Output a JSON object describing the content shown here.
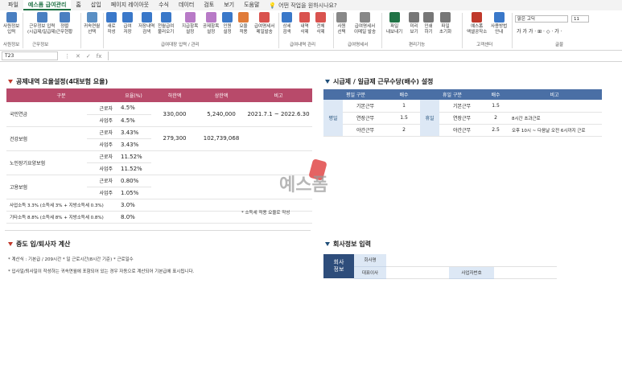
{
  "tabs": [
    "파일",
    "예스폼 급여관리",
    "홈",
    "삽입",
    "페이지 레이아웃",
    "수식",
    "데이터",
    "검토",
    "보기",
    "도움말"
  ],
  "tell_me": "어떤 작업을 원하시나요?",
  "ribbon": {
    "buttons": [
      {
        "label": "사원정보\n입력",
        "color": "#4a7fc1"
      },
      {
        "label": "근무정보 입력\n(시급제/일급제)",
        "color": "#4a7fc1"
      },
      {
        "label": "정렬\n근무현황",
        "color": "#4a7fc1"
      },
      {
        "label": "귀속연월\n선택",
        "color": "#5a8fc4"
      },
      {
        "label": "새로\n작성",
        "color": "#3a78c9"
      },
      {
        "label": "급여\n저장",
        "color": "#3a78c9"
      },
      {
        "label": "저장내역\n검색",
        "color": "#3a78c9"
      },
      {
        "label": "전월급여\n불러오기",
        "color": "#3a78c9"
      },
      {
        "label": "지급항목\n설정",
        "color": "#b87ac7"
      },
      {
        "label": "공제항목\n설정",
        "color": "#b87ac7"
      },
      {
        "label": "인원\n설정",
        "color": "#3a78c9"
      },
      {
        "label": "요율\n적용",
        "color": "#e07b39"
      },
      {
        "label": "급여명세서\n메일발송",
        "color": "#d9534f"
      },
      {
        "label": "상세\n검색",
        "color": "#3a78c9"
      },
      {
        "label": "내역\n삭제",
        "color": "#d9534f"
      },
      {
        "label": "전체\n삭제",
        "color": "#d9534f"
      },
      {
        "label": "사원\n선택",
        "color": "#888"
      },
      {
        "label": "급여명세서\n이메일 발송",
        "color": "#888"
      },
      {
        "label": "파일\n내보내기",
        "color": "#217346"
      },
      {
        "label": "미리\n보기",
        "color": "#777"
      },
      {
        "label": "인쇄\n하기",
        "color": "#777"
      },
      {
        "label": "파일\n초기화",
        "color": "#777"
      },
      {
        "label": "예스폼\n액셀공작소",
        "color": "#c0392b"
      },
      {
        "label": "사용방법\n안내",
        "color": "#3a78c9"
      }
    ],
    "groups": [
      "사원정보",
      "근무정보",
      "급여대장 입력 / 관리",
      "급여내역 관리",
      "급여명세서",
      "편리기능",
      "고객센터",
      "글꼴"
    ],
    "font_name": "맑은 고딕",
    "font_size": "11",
    "font_buttons": "가  가  가  ·  ⊞  ·  ◇  ·  가  ·"
  },
  "formula_bar": {
    "name_box": "T23",
    "icons": [
      "⋮",
      "✕",
      "✓",
      "fx"
    ]
  },
  "section1": {
    "title": "공제내역 요율설정(4대보험 요율)",
    "headers": [
      "구분",
      "요율(%)",
      "하한액",
      "상한액",
      "비고"
    ],
    "rows": [
      {
        "name": "국민연금",
        "sub": [
          [
            "근로자",
            "4.5%"
          ],
          [
            "사업주",
            "4.5%"
          ]
        ],
        "min": "330,000",
        "max": "5,240,000",
        "note": "2021.7.1 ~ 2022.6.30"
      },
      {
        "name": "건강보험",
        "sub": [
          [
            "근로자",
            "3.43%"
          ],
          [
            "사업주",
            "3.43%"
          ]
        ],
        "min": "279,300",
        "max": "102,739,068",
        "note": ""
      },
      {
        "name": "노인장기요양보험",
        "sub": [
          [
            "근로자",
            "11.52%"
          ],
          [
            "사업주",
            "11.52%"
          ]
        ],
        "min": "",
        "max": "",
        "note": ""
      },
      {
        "name": "고용보험",
        "sub": [
          [
            "근로자",
            "0.80%"
          ],
          [
            "사업주",
            "1.05%"
          ]
        ],
        "min": "",
        "max": "",
        "note": ""
      }
    ],
    "tax_rows": [
      {
        "name": "사업소득 3.3% (소득세 3% + 지방소득세 0.3%)",
        "rate": "3.0%"
      },
      {
        "name": "기타소득 8.8% (소득세 8% + 지방소득세 0.8%)",
        "rate": "8.0%"
      }
    ],
    "tax_note": "* 소득세 적용 요율로 작성"
  },
  "section2": {
    "title": "시급제 / 일급제 근무수당(배수) 설정",
    "headers": [
      "평일 구분",
      "배수",
      "휴일 구분",
      "배수",
      "비고"
    ],
    "weekday_label": "평일",
    "holiday_label": "휴일",
    "rows": [
      {
        "wd": "기본근무",
        "wdm": "1",
        "hd": "기본근무",
        "hdm": "1.5",
        "note": ""
      },
      {
        "wd": "연장근무",
        "wdm": "1.5",
        "hd": "연장근무",
        "hdm": "2",
        "note": "8시간 초과근로"
      },
      {
        "wd": "야간근무",
        "wdm": "2",
        "hd": "야간근무",
        "hdm": "2.5",
        "note": "오후 10시 ~ 다음날 오전 6시까지 근로"
      }
    ]
  },
  "section3": {
    "title": "중도 입/퇴사자 계산",
    "notes": [
      "* 계산식 : 기본급 / 209시간 * 일 근로시간(8시간 기준) * 근로일수",
      "* 입사일/퇴사일이 작성하는 귀속연월에 포함되어 있는 경우 자동으로 계산되어 기본급에 표시됩니다."
    ]
  },
  "section4": {
    "title": "회사정보 입력",
    "head": "회사\n정보",
    "labels": [
      "회사명",
      "대표이사",
      "사업자번호"
    ],
    "values": [
      "",
      "",
      ""
    ]
  },
  "watermark": "예스폼"
}
